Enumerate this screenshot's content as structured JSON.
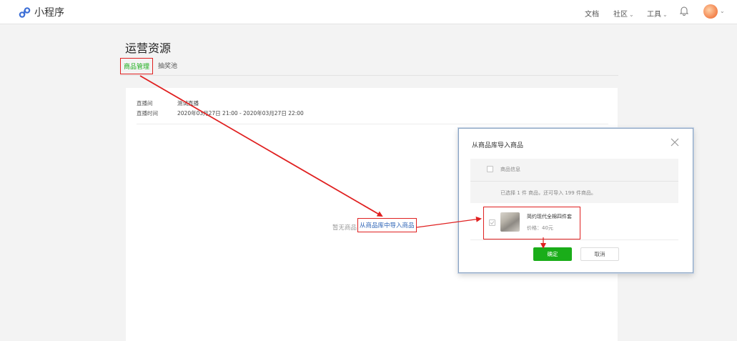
{
  "app": {
    "title": "小程序",
    "logo_icon": "wechat-miniprogram-logo-icon"
  },
  "topnav": {
    "docs": "文档",
    "community": "社区",
    "tools": "工具",
    "chevron": "⌄"
  },
  "page": {
    "title": "运营资源"
  },
  "tabs": [
    {
      "label": "商品管理",
      "active": true
    },
    {
      "label": "抽奖池",
      "active": false
    }
  ],
  "live": {
    "room_label": "直播间",
    "room_value": "测试直播",
    "time_label": "直播时间",
    "time_value": "2020年03月27日 21:00 - 2020年03月27日 22:00"
  },
  "empty": {
    "text": "暂无商品",
    "import_link": "从商品库中导入商品"
  },
  "modal": {
    "title": "从商品库导入商品",
    "header_label": "商品信息",
    "selected_note": "已选择 1 件 商品，还可导入 199 件商品。",
    "item": {
      "name": "简约现代全棉四件套",
      "price": "价格：40元",
      "checked": true
    },
    "confirm_label": "确定",
    "cancel_label": "取消"
  },
  "colors": {
    "accent_green": "#1aad19",
    "annotation_red": "#e02020",
    "link_blue": "#2c63b6"
  }
}
